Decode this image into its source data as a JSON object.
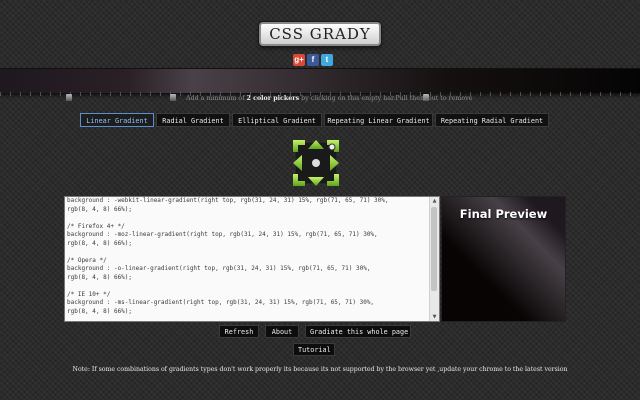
{
  "app": {
    "title": "CSS GRADY"
  },
  "social": [
    {
      "name": "google-plus-icon",
      "glyph": "g+"
    },
    {
      "name": "facebook-icon",
      "glyph": "f"
    },
    {
      "name": "twitter-icon",
      "glyph": "t"
    }
  ],
  "gradient_bar": {
    "info_before": "Add a minimum of ",
    "info_bold": "2 color pickers",
    "info_after": " by clicking on this empty bar.Pull them out to remove"
  },
  "tabs": [
    {
      "label": "Linear Gradient",
      "active": true
    },
    {
      "label": "Radial Gradient",
      "active": false
    },
    {
      "label": "Elliptical Gradient",
      "active": false
    },
    {
      "label": "Repeating Linear Gradient",
      "active": false
    },
    {
      "label": "Repeating Radial Gradient",
      "active": false
    }
  ],
  "direction_control": {
    "icon": "direction-arrows-icon",
    "accent": "#8bd12a"
  },
  "code": {
    "lines": [
      "background : -webkit-linear-gradient(right top, rgb(31, 24, 31) 15%, rgb(71, 65, 71) 30%,",
      "rgb(8, 4, 8) 66%);",
      "",
      "/* Firefox 4+ */",
      "background : -moz-linear-gradient(right top, rgb(31, 24, 31) 15%, rgb(71, 65, 71) 30%,",
      "rgb(8, 4, 8) 66%);",
      "",
      "/* Opera */",
      "background : -o-linear-gradient(right top, rgb(31, 24, 31) 15%, rgb(71, 65, 71) 30%,",
      "rgb(8, 4, 8) 66%);",
      "",
      "/* IE 10+ */",
      "background : -ms-linear-gradient(right top, rgb(31, 24, 31) 15%, rgb(71, 65, 71) 30%,",
      "rgb(8, 4, 8) 66%);"
    ]
  },
  "preview": {
    "title": "Final Preview"
  },
  "buttons": {
    "refresh": "Refresh",
    "about": "About",
    "gradiate": "Gradiate this whole page",
    "tutorial": "Tutorial"
  },
  "note": "Note: If some combinations of gradients types don't work properly its because its not supported by the browser yet ,update your chrome to the latest version",
  "colors": {
    "accent_tab": "#8fc1ff",
    "stop1": "#1f181f",
    "stop2": "#474147",
    "stop3": "#080408"
  }
}
